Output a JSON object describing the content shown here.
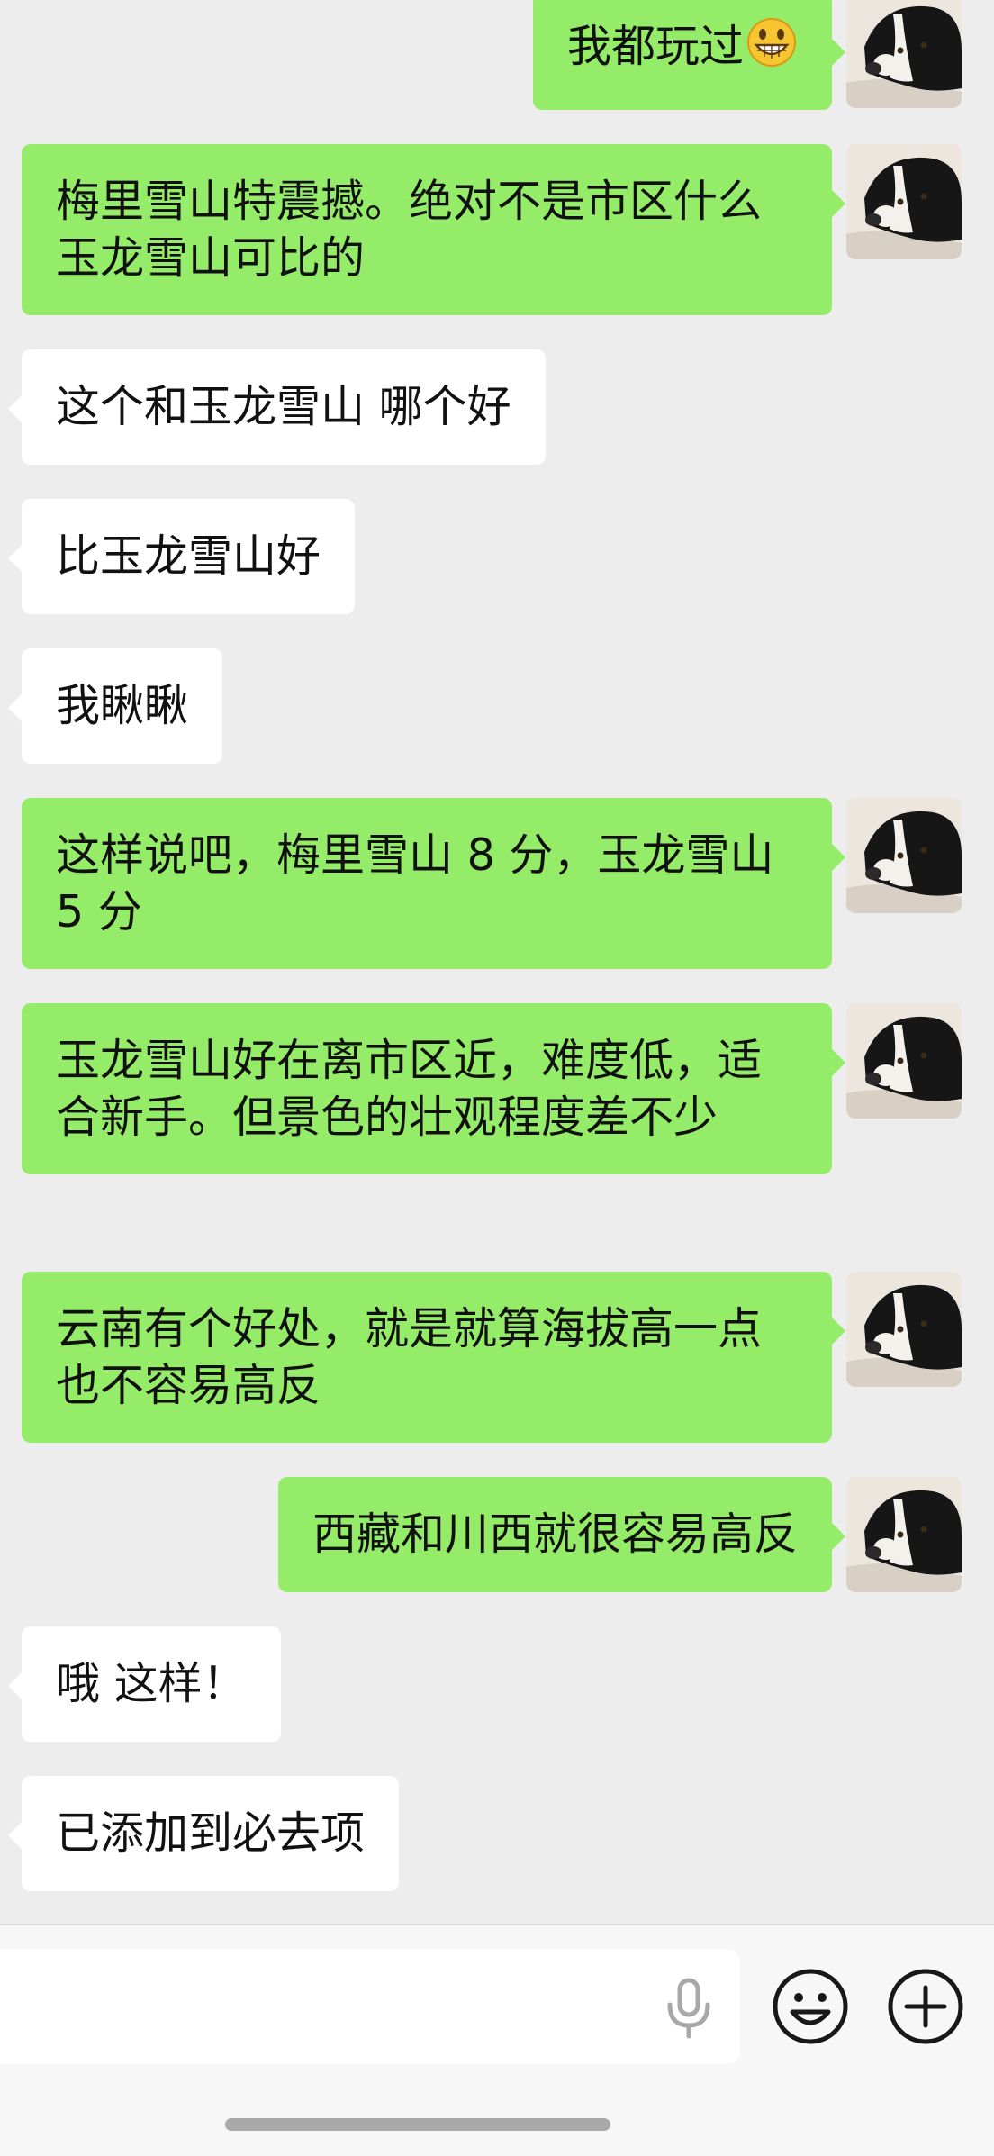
{
  "chat": {
    "messages": [
      {
        "side": "me",
        "text": "我都玩过",
        "emoji": "grinning-face-emoji"
      },
      {
        "side": "me",
        "text": "梅里雪山特震撼。绝对不是市区什么玉龙雪山可比的"
      },
      {
        "side": "other",
        "text": "这个和玉龙雪山 哪个好"
      },
      {
        "side": "other",
        "text": "比玉龙雪山好"
      },
      {
        "side": "other",
        "text": "我瞅瞅"
      },
      {
        "side": "me",
        "text": "这样说吧，梅里雪山 8 分，玉龙雪山 5 分"
      },
      {
        "side": "me",
        "text": "玉龙雪山好在离市区近，难度低，适合新手。但景色的壮观程度差不少"
      },
      {
        "side": "me",
        "text": "云南有个好处，就是就算海拔高一点也不容易高反"
      },
      {
        "side": "me",
        "text": "西藏和川西就很容易高反"
      },
      {
        "side": "other",
        "text": "哦 这样！"
      },
      {
        "side": "other",
        "text": "已添加到必去项"
      }
    ]
  },
  "input_bar": {
    "value": "",
    "icons": [
      "microphone-icon",
      "emoji-icon",
      "plus-icon"
    ]
  },
  "colors": {
    "background": "#ededed",
    "my_bubble": "#95ec69",
    "other_bubble": "#ffffff",
    "text": "#111111"
  }
}
